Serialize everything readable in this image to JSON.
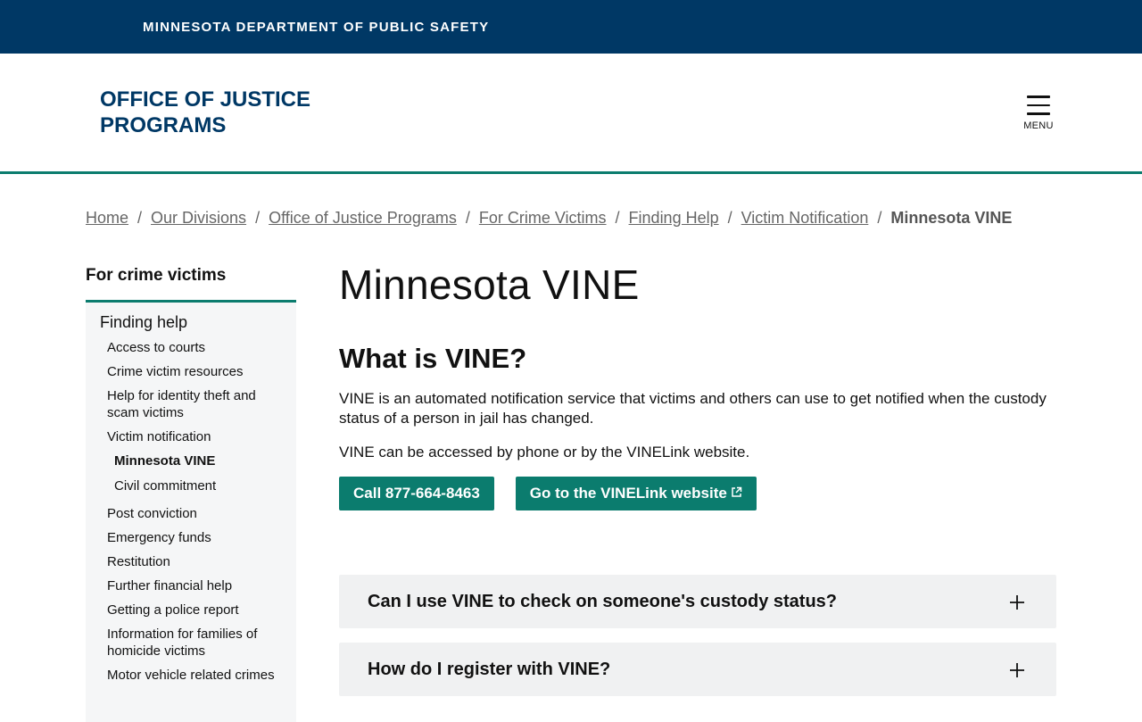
{
  "topbar": {
    "title": "MINNESOTA DEPARTMENT OF PUBLIC SAFETY"
  },
  "header": {
    "org_title": "OFFICE OF JUSTICE PROGRAMS",
    "menu_label": "MENU"
  },
  "breadcrumb": {
    "items": [
      "Home",
      "Our Divisions",
      "Office of Justice Programs",
      "For Crime Victims",
      "Finding Help",
      "Victim Notification"
    ],
    "current": "Minnesota VINE",
    "separator": "/"
  },
  "sidebar": {
    "heading": "For crime victims",
    "top_item": "Finding help",
    "items": [
      "Access to courts",
      "Crime victim resources",
      "Help for identity theft and scam victims",
      "Victim notification"
    ],
    "subitems": [
      "Minnesota VINE",
      "Civil commitment"
    ],
    "items_after": [
      "Post conviction",
      "Emergency funds",
      "Restitution",
      "Further financial help",
      "Getting a police report",
      "Information for families of homicide victims",
      "Motor vehicle related crimes"
    ]
  },
  "main": {
    "title": "Minnesota VINE",
    "section_heading": "What is VINE?",
    "para1": "VINE is an automated notification service that victims and others can use to get notified when the custody status of a person in jail has changed.",
    "para2": "VINE can be accessed by phone or by the VINELink website.",
    "call_button": "Call 877-664-8463",
    "website_button": "Go to the VINELink website"
  },
  "accordion": [
    {
      "question": "Can I use VINE to check on someone's custody status?"
    },
    {
      "question": "How do I register with VINE?"
    }
  ],
  "colors": {
    "navy": "#003865",
    "teal": "#0b7c6e",
    "panel": "#f0f1f2"
  }
}
